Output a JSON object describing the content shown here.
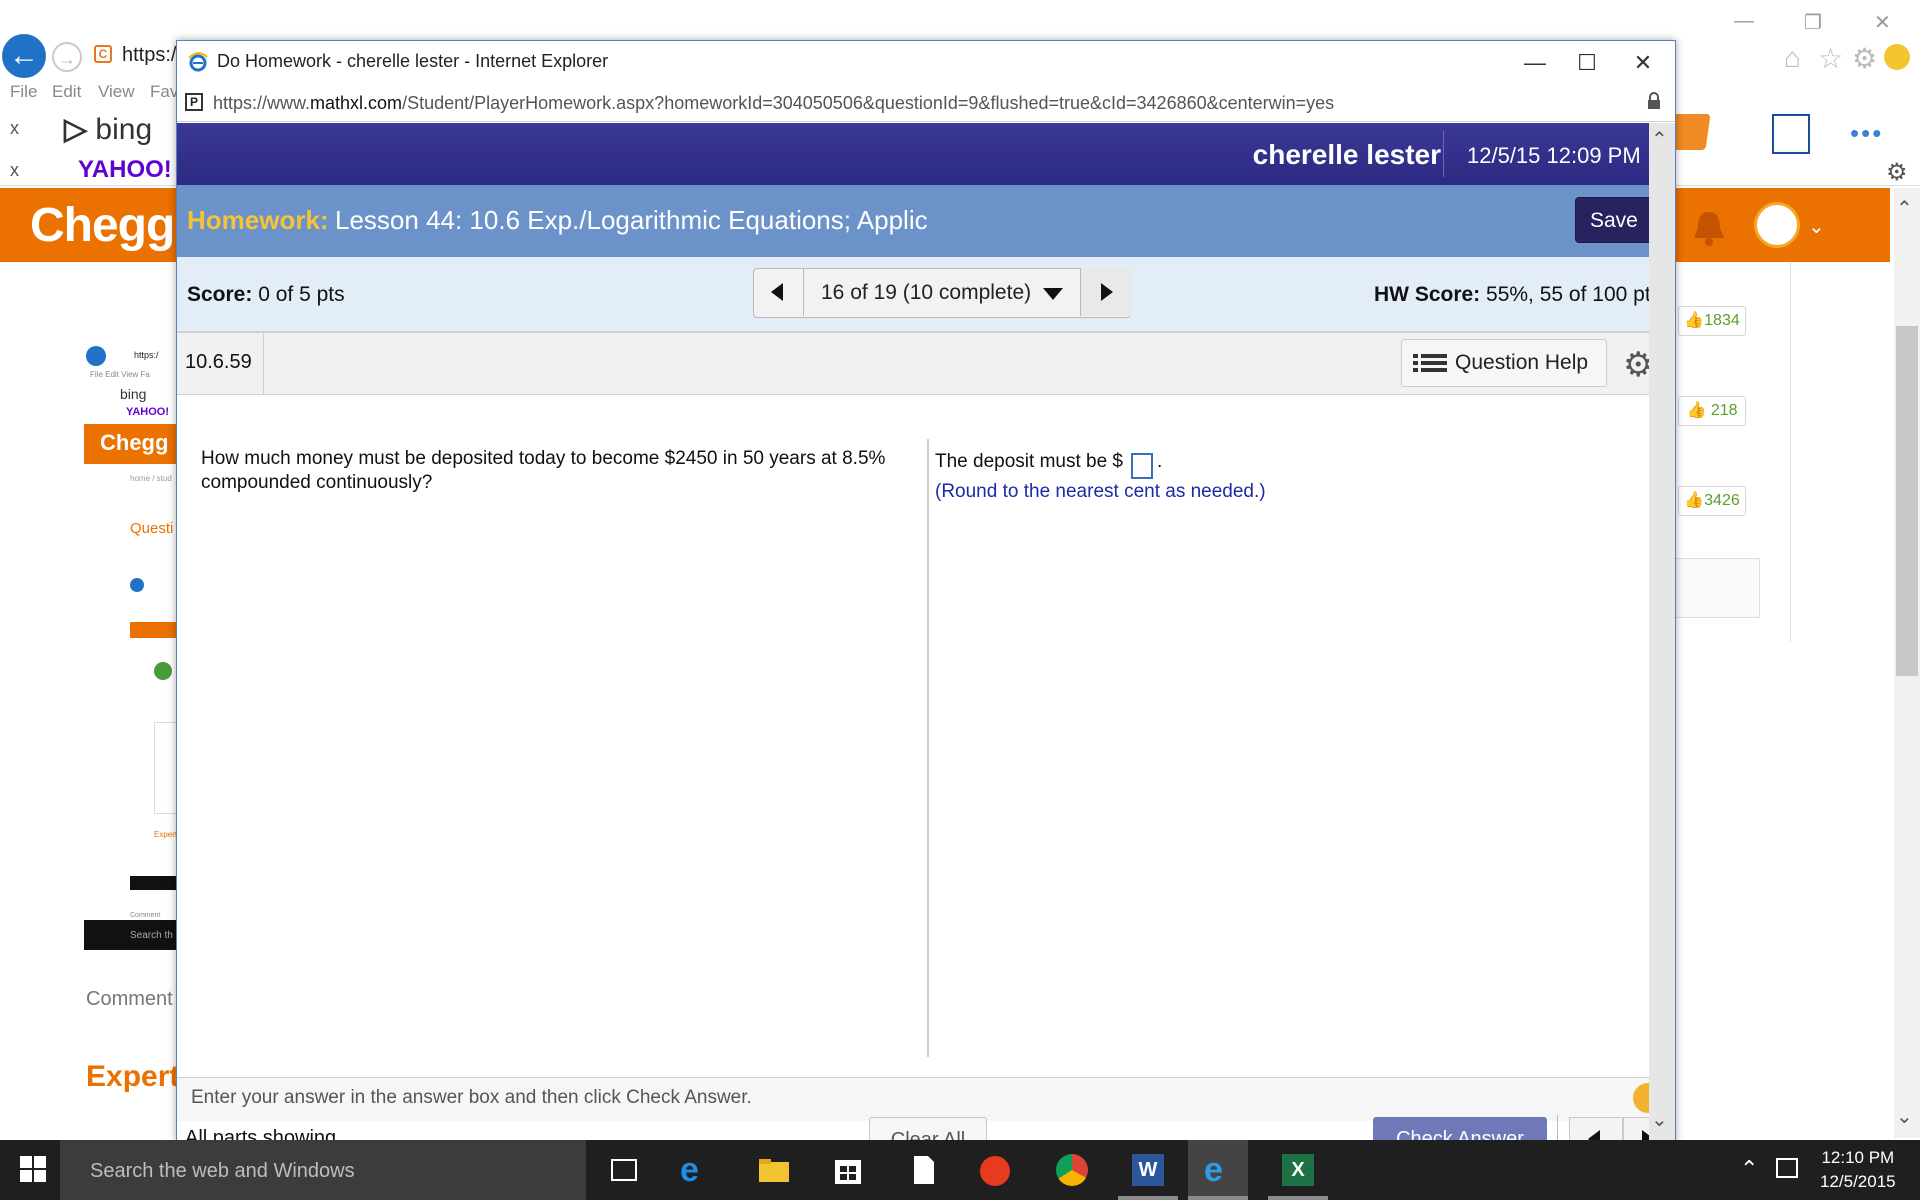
{
  "background_browser": {
    "url_partial": "https:/",
    "menu": [
      "File",
      "Edit",
      "View",
      "Fav"
    ],
    "bing_label": "bing",
    "yahoo_label": "YAHOO!",
    "close_x": "x",
    "chegg_logo": "Chegg",
    "likes": [
      "1834",
      "218",
      "3426"
    ],
    "comment_label": "Comment",
    "expert_label": "Expert",
    "thumb": {
      "url": "https:/",
      "menu": "File  Edit  View  Fa",
      "bing": "bing",
      "yahoo": "YAHOO!",
      "chegg": "Chegg",
      "breadcrumb": "home / stud",
      "question": "Questi",
      "expert": "Expert",
      "search": "Search th",
      "comment": "Comment"
    }
  },
  "ie_window": {
    "title": "Do Homework - cherelle lester - Internet Explorer",
    "url_prefix": "https://www.",
    "url_domain": "mathxl.com",
    "url_path": "/Student/PlayerHomework.aspx?homeworkId=304050506&questionId=9&flushed=true&cId=3426860&centerwin=yes",
    "minimize": "—",
    "maximize": "☐",
    "close": "✕"
  },
  "mathxl": {
    "user_name": "cherelle lester",
    "datetime": "12/5/15 12:09 PM",
    "homework_label": "Homework:",
    "homework_title": "Lesson 44: 10.6 Exp./Logarithmic Equations; Applic",
    "save_label": "Save",
    "score_label": "Score:",
    "score_value": "0 of 5 pts",
    "nav_text": "16 of 19 (10 complete)",
    "hw_score_label": "HW Score:",
    "hw_score_value": "55%, 55 of 100 pt",
    "question_number": "10.6.59",
    "question_help_label": "Question Help",
    "question_text": "How much money must be deposited today to become $2450 in 50 years at 8.5% compounded continuously?",
    "answer_prefix": "The deposit must be $",
    "answer_value": "",
    "answer_suffix": ".",
    "answer_hint": "(Round to the nearest cent as needed.)",
    "instruction": "Enter your answer in the answer box and then click Check Answer.",
    "parts_showing": "All parts showing",
    "clear_all_label": "Clear All",
    "check_answer_label": "Check Answer"
  },
  "taskbar": {
    "search_placeholder": "Search the web and Windows",
    "time": "12:10 PM",
    "date": "12/5/2015"
  },
  "colors": {
    "mathxl_header": "#2c2a82",
    "homework_bar": "#6b93c9",
    "homework_label": "#f6c338",
    "chegg_orange": "#eb7100",
    "hint_blue": "#1c2aa8",
    "check_button": "#6f78b8"
  }
}
